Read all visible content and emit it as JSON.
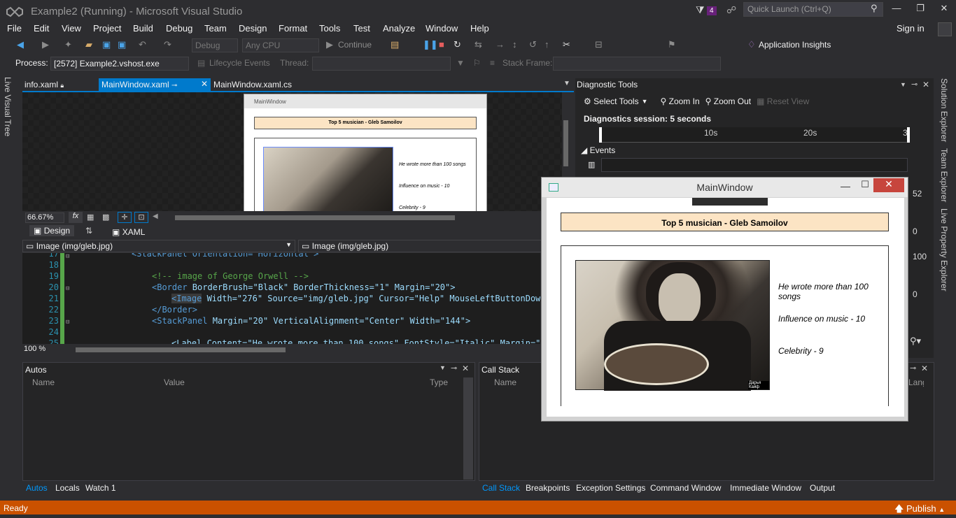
{
  "title_bar": {
    "app_title": "Example2 (Running) - Microsoft Visual Studio",
    "notification_count": "4",
    "quick_launch_placeholder": "Quick Launch (Ctrl+Q)"
  },
  "menu": [
    "File",
    "Edit",
    "View",
    "Project",
    "Build",
    "Debug",
    "Team",
    "Design",
    "Format",
    "Tools",
    "Test",
    "Analyze",
    "Window",
    "Help"
  ],
  "sign_in": "Sign in",
  "toolbar": {
    "config": "Debug",
    "platform": "Any CPU",
    "continue": "Continue",
    "app_insights": "Application Insights"
  },
  "debug_bar": {
    "process_label": "Process:",
    "process_value": "[2572] Example2.vshost.exe",
    "lifecycle": "Lifecycle Events",
    "thread_label": "Thread:",
    "stack_frame_label": "Stack Frame:"
  },
  "left_strip": "Live Visual Tree",
  "doc_tabs": [
    "info.xaml",
    "MainWindow.xaml",
    "MainWindow.xaml.cs"
  ],
  "designer": {
    "window_title": "MainWindow",
    "header": "Top 5 musician - Gleb Samoilov",
    "labels": [
      "He wrote more than 100 songs",
      "Influence on music - 10",
      "Celebrity - 9"
    ],
    "zoom": "66.67%",
    "fx": "fx"
  },
  "split_tabs": {
    "design": "Design",
    "xaml": "XAML"
  },
  "nav": {
    "left": "Image (img/gleb.jpg)",
    "right": "Image (img/gleb.jpg)"
  },
  "code": {
    "line_numbers": [
      "17",
      "18",
      "19",
      "20",
      "21",
      "22",
      "23",
      "24",
      "25"
    ],
    "l17": "<StackPanel Orientation=\"Horizontal\">",
    "l19": "<!-- image of George Orwell -->",
    "l20_tag": "<Border",
    "l20_attrs": " BorderBrush=\"Black\" BorderThickness=\"1\" Margin=\"20\">",
    "l21_tag": "<Image",
    "l21_attrs": " Width=\"276\" Source=\"img/gleb.jpg\" Cursor=\"Help\" MouseLeftButtonDown=\"",
    "l22": "</Border>",
    "l23_tag": "<StackPanel",
    "l23_attrs": " Margin=\"20\" VerticalAlignment=\"Center\" Width=\"144\">",
    "l25": "<Label Content=\"He wrote more than 100 songs\" FontStyle=\"Italic\" Margin=\"3\"",
    "zoom": "100 %"
  },
  "autos": {
    "title": "Autos",
    "columns": [
      "Name",
      "Value",
      "Type"
    ],
    "tabs": [
      "Autos",
      "Locals",
      "Watch 1"
    ]
  },
  "call_stack": {
    "title": "Call Stack",
    "columns": [
      "Name",
      "Lang"
    ],
    "tabs": [
      "Call Stack",
      "Breakpoints",
      "Exception Settings",
      "Command Window",
      "Immediate Window",
      "Output"
    ]
  },
  "diagnostics": {
    "title": "Diagnostic Tools",
    "select_tools": "Select Tools",
    "zoom_in": "Zoom In",
    "zoom_out": "Zoom Out",
    "reset_view": "Reset View",
    "session": "Diagnostics session: 5 seconds",
    "ticks": [
      "10s",
      "20s",
      "3"
    ],
    "events": "Events",
    "values": [
      "52",
      "0",
      "100",
      "0"
    ]
  },
  "right_strip": [
    "Solution Explorer",
    "Team Explorer",
    "Live Property Explorer"
  ],
  "app_window": {
    "title": "MainWindow",
    "header": "Top 5 musician - Gleb Samoilov",
    "labels": [
      "He wrote more than 100 songs",
      "Influence on music - 10",
      "Celebrity - 9"
    ],
    "watermark": "Дарья Кайф"
  },
  "status": {
    "text": "Ready",
    "publish": "Publish"
  },
  "colors": {
    "accent": "#007acc",
    "status": "#ca5100",
    "close": "#c7453d",
    "header_fill": "#fce4c4"
  }
}
